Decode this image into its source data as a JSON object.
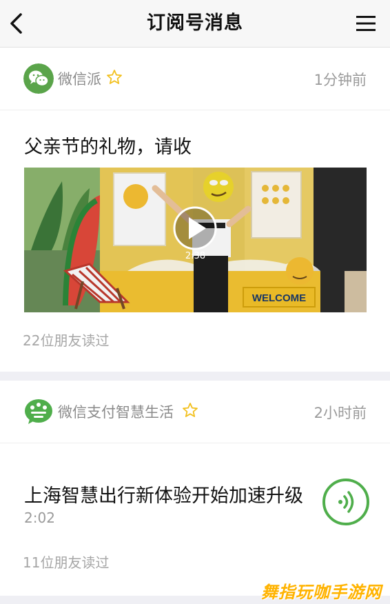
{
  "nav": {
    "title": "订阅号消息",
    "back_icon": "chevron-left-icon",
    "menu_icon": "hamburger-menu-icon"
  },
  "messages": [
    {
      "account_name": "微信派",
      "timestamp": "1分钟前",
      "title": "父亲节的礼物，请收",
      "video": {
        "duration": "2:38",
        "sign_text": "WELCOME",
        "play_icon": "play-icon"
      },
      "reads": "22位朋友读过"
    },
    {
      "account_name": "微信支付智慧生活",
      "timestamp": "2小时前",
      "title": "上海智慧出行新体验开始加速升级",
      "audio_duration": "2:02",
      "audio_icon": "audio-play-icon",
      "reads": "11位朋友读过"
    }
  ],
  "colors": {
    "accent_green": "#4fae4b",
    "star_yellow": "#f2c01e"
  },
  "watermark": "舞指玩咖手游网"
}
